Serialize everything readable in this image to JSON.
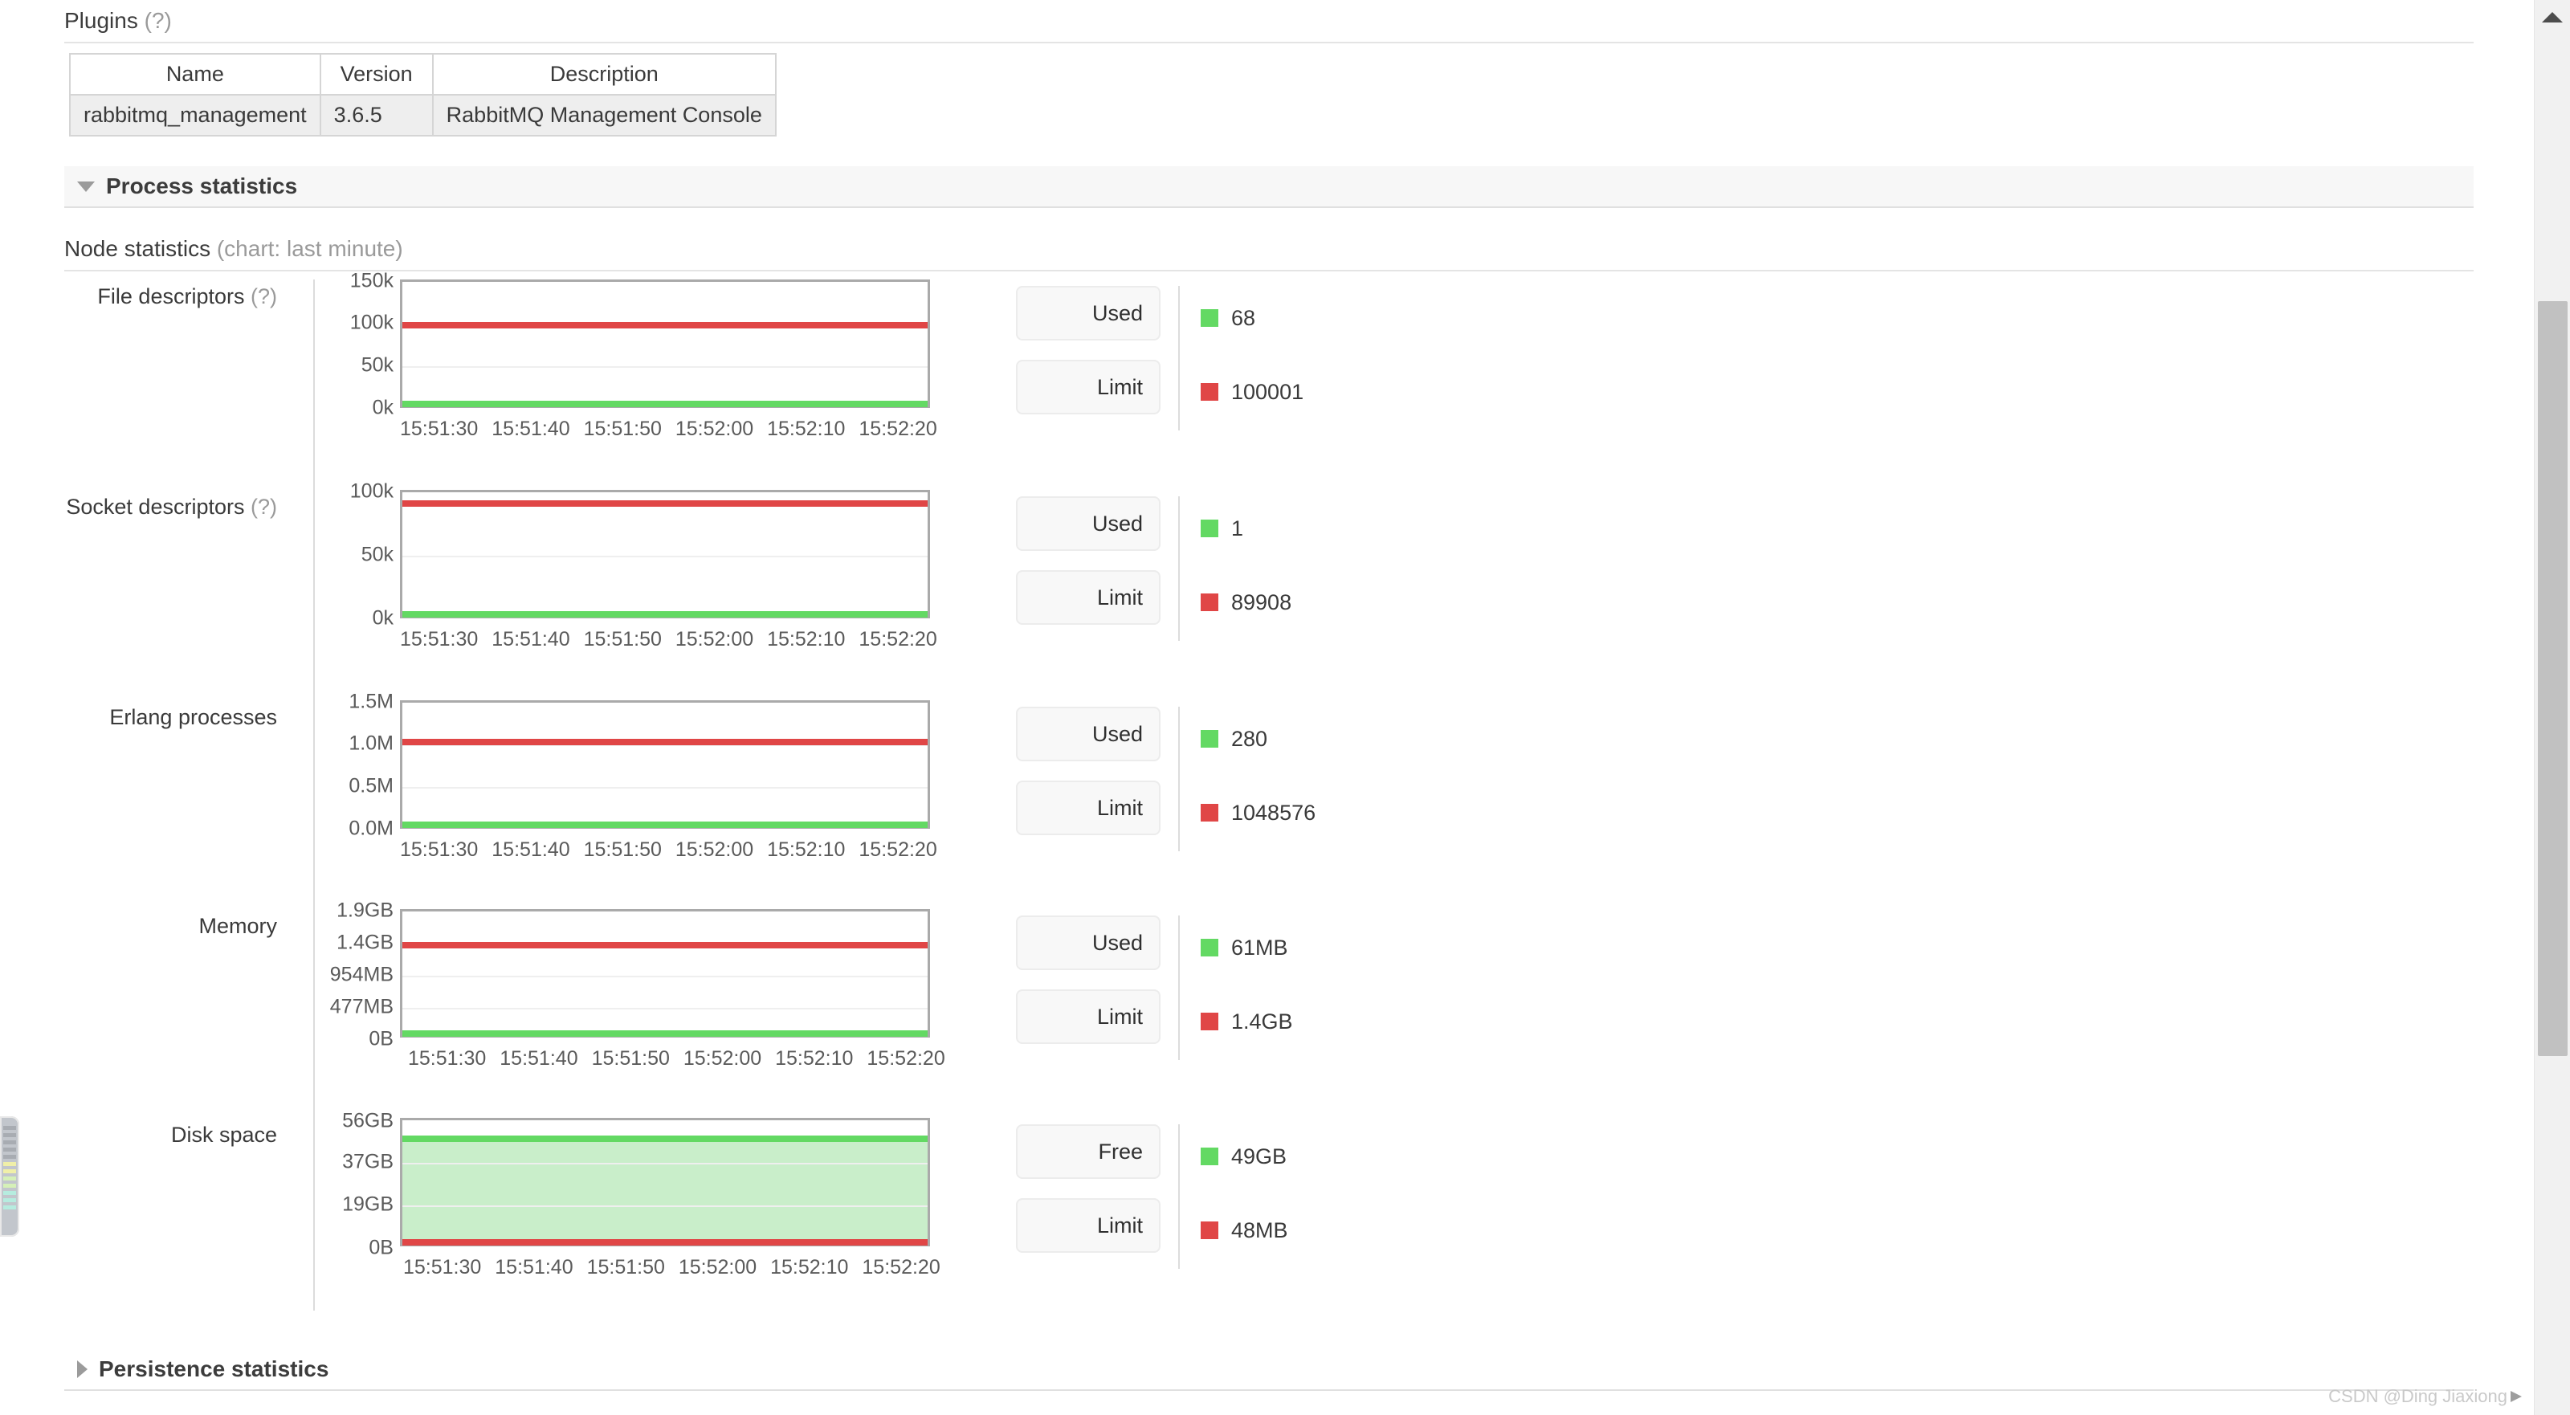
{
  "plugins": {
    "heading": "Plugins",
    "help": "(?)",
    "columns": [
      "Name",
      "Version",
      "Description"
    ],
    "rows": [
      [
        "rabbitmq_management",
        "3.6.5",
        "RabbitMQ Management Console"
      ]
    ]
  },
  "process_statistics": {
    "title": "Process statistics",
    "expanded_icon": "triangle-down-icon"
  },
  "node_statistics": {
    "title": "Node statistics",
    "subtitle": "(chart: last minute)"
  },
  "persistence_statistics": {
    "title": "Persistence statistics",
    "collapsed_icon": "triangle-right-icon"
  },
  "colors": {
    "green": "#63d963",
    "red": "#e04646",
    "green_fill": "#c9eeca",
    "axis": "#aaaaaa",
    "grid": "#efefef"
  },
  "watermark": "CSDN @Ding Jiaxiong",
  "chart_data": [
    {
      "type": "line",
      "title": "File descriptors",
      "help": "(?)",
      "ylabel": "",
      "xlabel": "",
      "yticks": [
        "0k",
        "50k",
        "100k",
        "150k"
      ],
      "ytick_values": [
        0,
        50000,
        100000,
        150000
      ],
      "ylim": [
        0,
        150000
      ],
      "xticks": [
        "15:51:30",
        "15:51:40",
        "15:51:50",
        "15:52:00",
        "15:52:10",
        "15:52:20"
      ],
      "grid": true,
      "series": [
        {
          "name": "Used",
          "color": "#63d963",
          "value": 68,
          "display": "68",
          "level": 68
        },
        {
          "name": "Limit",
          "color": "#e04646",
          "value": 100001,
          "display": "100001",
          "level": 100001
        }
      ]
    },
    {
      "type": "line",
      "title": "Socket descriptors",
      "help": "(?)",
      "ylabel": "",
      "xlabel": "",
      "yticks": [
        "0k",
        "50k",
        "100k"
      ],
      "ytick_values": [
        0,
        50000,
        100000
      ],
      "ylim": [
        0,
        100000
      ],
      "xticks": [
        "15:51:30",
        "15:51:40",
        "15:51:50",
        "15:52:00",
        "15:52:10",
        "15:52:20"
      ],
      "grid": true,
      "series": [
        {
          "name": "Used",
          "color": "#63d963",
          "value": 1,
          "display": "1",
          "level": 1
        },
        {
          "name": "Limit",
          "color": "#e04646",
          "value": 89908,
          "display": "89908",
          "level": 89908
        }
      ]
    },
    {
      "type": "line",
      "title": "Erlang processes",
      "help": "",
      "ylabel": "",
      "xlabel": "",
      "yticks": [
        "0.0M",
        "0.5M",
        "1.0M",
        "1.5M"
      ],
      "ytick_values": [
        0,
        500000,
        1000000,
        1500000
      ],
      "ylim": [
        0,
        1500000
      ],
      "xticks": [
        "15:51:30",
        "15:51:40",
        "15:51:50",
        "15:52:00",
        "15:52:10",
        "15:52:20"
      ],
      "grid": true,
      "series": [
        {
          "name": "Used",
          "color": "#63d963",
          "value": 280,
          "display": "280",
          "level": 280
        },
        {
          "name": "Limit",
          "color": "#e04646",
          "value": 1048576,
          "display": "1048576",
          "level": 1048576
        }
      ]
    },
    {
      "type": "line",
      "title": "Memory",
      "help": "",
      "ylabel": "",
      "xlabel": "",
      "yticks": [
        "0B",
        "477MB",
        "954MB",
        "1.4GB",
        "1.9GB"
      ],
      "ytick_values": [
        0,
        477,
        954,
        1433,
        1908
      ],
      "ylim": [
        0,
        1908
      ],
      "xticks": [
        "15:51:30",
        "15:51:40",
        "15:51:50",
        "15:52:00",
        "15:52:10",
        "15:52:20"
      ],
      "grid": true,
      "series": [
        {
          "name": "Used",
          "color": "#63d963",
          "value": 61,
          "display": "61MB",
          "level": 61
        },
        {
          "name": "Limit",
          "color": "#e04646",
          "value": 1433,
          "display": "1.4GB",
          "level": 1433
        }
      ]
    },
    {
      "type": "area",
      "title": "Disk space",
      "help": "",
      "ylabel": "",
      "xlabel": "",
      "yticks": [
        "0B",
        "19GB",
        "37GB",
        "56GB"
      ],
      "ytick_values": [
        0,
        19,
        37,
        56
      ],
      "ylim": [
        0,
        56
      ],
      "xticks": [
        "15:51:30",
        "15:51:40",
        "15:51:50",
        "15:52:00",
        "15:52:10",
        "15:52:20"
      ],
      "grid": true,
      "series": [
        {
          "name": "Free",
          "color": "#63d963",
          "value": 49,
          "display": "49GB",
          "level": 49
        },
        {
          "name": "Limit",
          "color": "#e04646",
          "value": 0.048,
          "display": "48MB",
          "level": 0.048
        }
      ]
    }
  ]
}
